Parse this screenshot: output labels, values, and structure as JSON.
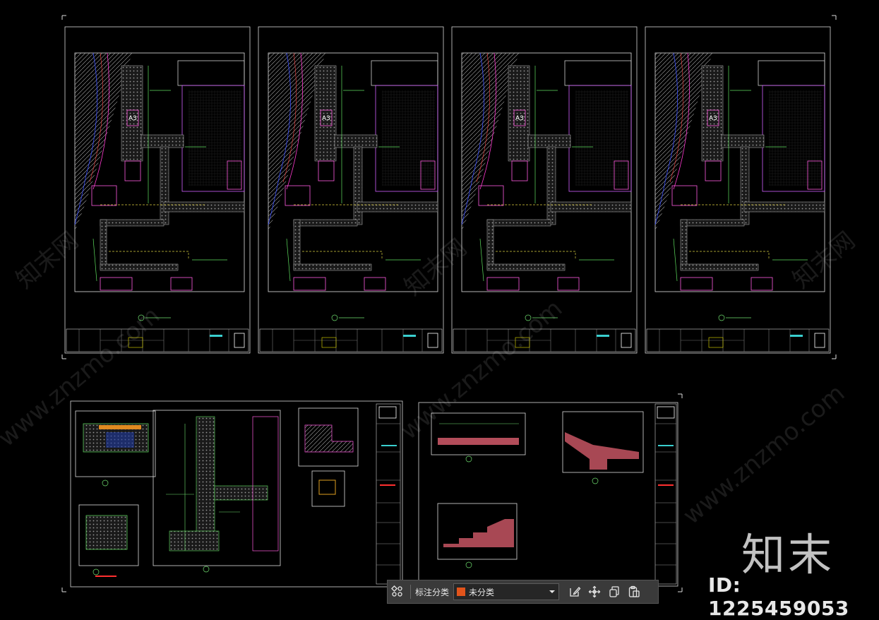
{
  "watermark": {
    "site": "www.znzmo.com",
    "brand_cn": "知末网",
    "logo_text": "知末",
    "id_text": "ID: 1225459053"
  },
  "toolbar": {
    "label": "标注分类",
    "selected_category": "未分类",
    "accent_color": "#e2541b"
  },
  "icons": [
    "grid-apps-icon",
    "edit-icon",
    "move-icon",
    "copy-icon",
    "paste-icon",
    "chevron-down-icon"
  ]
}
